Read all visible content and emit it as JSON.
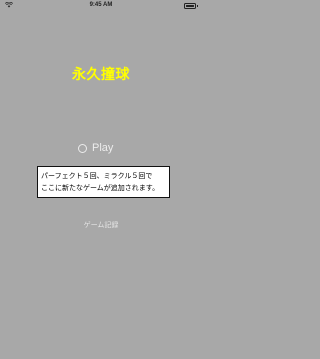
{
  "status_bar": {
    "time": "9:45 AM",
    "wifi_icon": "wifi-icon",
    "battery_icon": "battery-icon"
  },
  "title": "永久撞球",
  "title_color": "#ffff00",
  "play": {
    "icon": "play-circle-icon",
    "label": "Play"
  },
  "notice": {
    "line1": "パーフェクト５回、ミラクル５回で",
    "line2": "ここに新たなゲームが追加されます。"
  },
  "records_button": {
    "label": "ゲーム記録"
  },
  "background_color": "#a8a8a8"
}
